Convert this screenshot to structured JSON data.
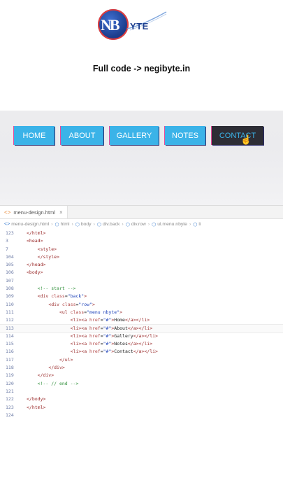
{
  "logo": {
    "mark": "NB",
    "text": "YTE"
  },
  "tagline": "Full code -> negibyte.in",
  "colors": {
    "menu_bg": "#3bb3e8",
    "menu_active_bg": "#2d2d35",
    "comment": "#2f8f3a",
    "tag": "#9a2a2a"
  },
  "menu": {
    "items": [
      {
        "label": "HOME"
      },
      {
        "label": "ABOUT"
      },
      {
        "label": "GALLERY"
      },
      {
        "label": "NOTES"
      },
      {
        "label": "CONTACT"
      }
    ],
    "active": "CONTACT"
  },
  "editor": {
    "tab": {
      "icon": "html-file-icon",
      "filename": "menu-design.html",
      "close": "×"
    },
    "breadcrumb": [
      "menu-design.html",
      "html",
      "body",
      "div.back",
      "div.row",
      "ul.menu.nbyte",
      "li"
    ],
    "lines": [
      {
        "n": "123",
        "code": "</html>"
      },
      {
        "n": "3",
        "code": "<head>"
      },
      {
        "n": "7",
        "code": "    <style>"
      },
      {
        "n": "104",
        "code": "    </style>"
      },
      {
        "n": "105",
        "code": "</head>"
      },
      {
        "n": "106",
        "code": "<body>"
      },
      {
        "n": "107",
        "code": ""
      },
      {
        "n": "108",
        "code": "    <!-- start -->"
      },
      {
        "n": "109",
        "code": "    <div class=\"back\">"
      },
      {
        "n": "110",
        "code": "        <div class=\"row\">"
      },
      {
        "n": "111",
        "code": "            <ul class=\"menu nbyte\">"
      },
      {
        "n": "112",
        "code": "                <li><a href=\"#\">Home</a></li>"
      },
      {
        "n": "113",
        "code": "                <li><a href=\"#\">About</a></li>"
      },
      {
        "n": "114",
        "code": "                <li><a href=\"#\">Gallery</a></li>"
      },
      {
        "n": "115",
        "code": "                <li><a href=\"#\">Notes</a></li>"
      },
      {
        "n": "116",
        "code": "                <li><a href=\"#\">Contact</a></li>"
      },
      {
        "n": "117",
        "code": "            </ul>"
      },
      {
        "n": "118",
        "code": "        </div>"
      },
      {
        "n": "119",
        "code": "    </div>"
      },
      {
        "n": "120",
        "code": "    <!-- // end -->"
      },
      {
        "n": "121",
        "code": ""
      },
      {
        "n": "122",
        "code": "</body>"
      },
      {
        "n": "123",
        "code": "</html>"
      },
      {
        "n": "124",
        "code": ""
      }
    ],
    "current_line": "113"
  }
}
